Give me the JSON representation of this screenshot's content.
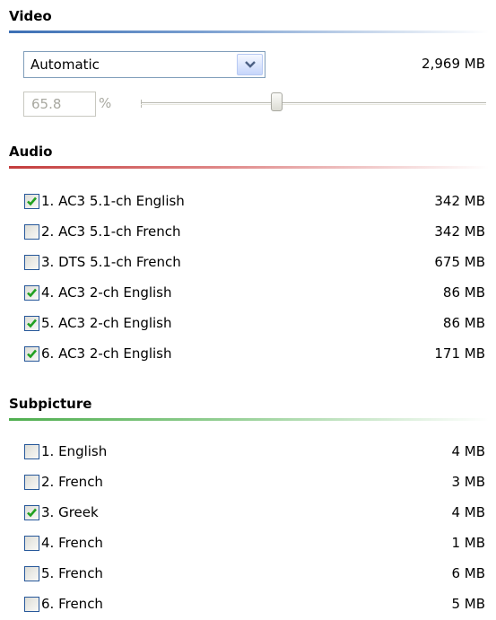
{
  "video": {
    "title": "Video",
    "rule_color": "#4b7bbd",
    "quality_select": {
      "value": "Automatic",
      "icon": "chevron-down-icon"
    },
    "size": "2,969 MB",
    "percent_value": "65.8",
    "percent_unit": "%",
    "slider_level": 0.38
  },
  "audio": {
    "title": "Audio",
    "rule_color": "#c94848",
    "tracks": [
      {
        "label": "1. AC3 5.1-ch English",
        "size": "342 MB",
        "checked": true
      },
      {
        "label": "2. AC3 5.1-ch French",
        "size": "342 MB",
        "checked": false
      },
      {
        "label": "3. DTS 5.1-ch French",
        "size": "675 MB",
        "checked": false
      },
      {
        "label": "4. AC3 2-ch English",
        "size": "86 MB",
        "checked": true
      },
      {
        "label": "5. AC3 2-ch English",
        "size": "86 MB",
        "checked": true
      },
      {
        "label": "6. AC3 2-ch English",
        "size": "171 MB",
        "checked": true
      }
    ]
  },
  "subpicture": {
    "title": "Subpicture",
    "rule_color": "#5cb85c",
    "tracks": [
      {
        "label": "1. English",
        "size": "4 MB",
        "checked": false
      },
      {
        "label": "2. French",
        "size": "3 MB",
        "checked": false
      },
      {
        "label": "3. Greek",
        "size": "4 MB",
        "checked": true
      },
      {
        "label": "4. French",
        "size": "1 MB",
        "checked": false
      },
      {
        "label": "5. French",
        "size": "6 MB",
        "checked": false
      },
      {
        "label": "6. French",
        "size": "5 MB",
        "checked": false
      }
    ]
  },
  "colors": {
    "checkbox_border": "#27589a",
    "checkmark": "#21a121",
    "disabled_text": "#a8a8a0"
  }
}
